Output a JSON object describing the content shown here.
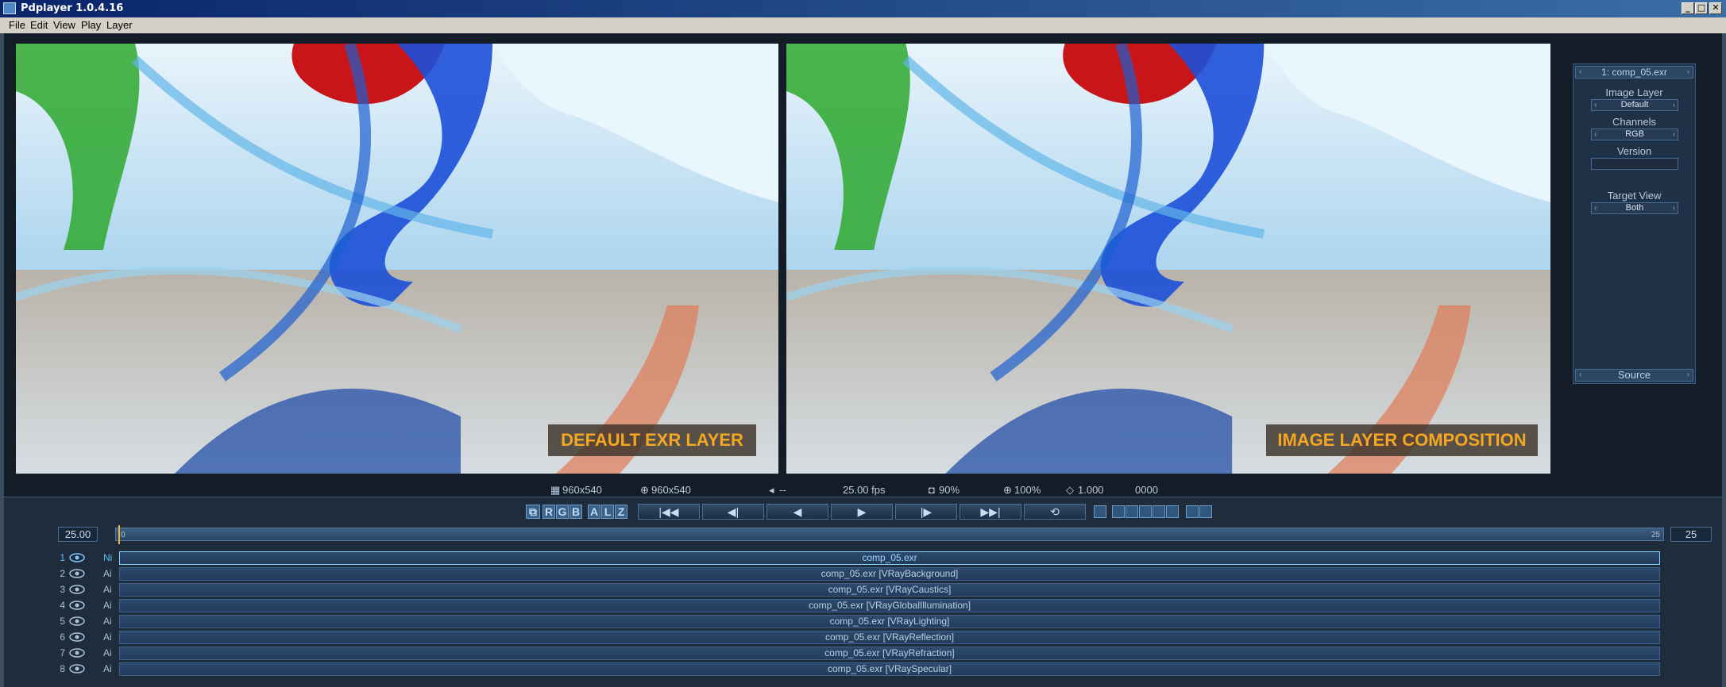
{
  "window": {
    "title": "Pdplayer 1.0.4.16",
    "controls": [
      "_",
      "□",
      "✕"
    ]
  },
  "menu": [
    "File",
    "Edit",
    "View",
    "Play",
    "Layer"
  ],
  "viewers": {
    "left_badge": "DEFAULT EXR LAYER",
    "right_badge": "IMAGE LAYER COMPOSITION"
  },
  "side_panel": {
    "header": "1: comp_05.exr",
    "image_layer_label": "Image Layer",
    "image_layer_value": "Default",
    "channels_label": "Channels",
    "channels_value": "RGB",
    "version_label": "Version",
    "version_value": "",
    "target_view_label": "Target View",
    "target_view_value": "Both",
    "footer": "Source"
  },
  "status": {
    "resolution": "960x540",
    "display_resolution": "960x540",
    "audio": "--",
    "fps": "25.00 fps",
    "quality": "90%",
    "zoom": "100%",
    "gamma": "1.000",
    "frame": "0000"
  },
  "transport": {
    "channels": [
      "R",
      "G",
      "B",
      "A",
      "L",
      "Z"
    ],
    "buttons": [
      "|◀◀",
      "◀|",
      "◀",
      "▶",
      "|▶",
      "▶▶|",
      "⟲"
    ]
  },
  "timeline": {
    "fps_value": "25.00",
    "end_value": "25",
    "start_label": "0",
    "end_label": "25"
  },
  "layers": [
    {
      "num": "1",
      "flag": "Ni",
      "name": "comp_05.exr"
    },
    {
      "num": "2",
      "flag": "Ai",
      "name": "comp_05.exr [VRayBackground]"
    },
    {
      "num": "3",
      "flag": "Ai",
      "name": "comp_05.exr [VRayCaustics]"
    },
    {
      "num": "4",
      "flag": "Ai",
      "name": "comp_05.exr [VRayGlobalIllumination]"
    },
    {
      "num": "5",
      "flag": "Ai",
      "name": "comp_05.exr [VRayLighting]"
    },
    {
      "num": "6",
      "flag": "Ai",
      "name": "comp_05.exr [VRayReflection]"
    },
    {
      "num": "7",
      "flag": "Ai",
      "name": "comp_05.exr [VRayRefraction]"
    },
    {
      "num": "8",
      "flag": "Ai",
      "name": "comp_05.exr [VRaySpecular]"
    }
  ]
}
